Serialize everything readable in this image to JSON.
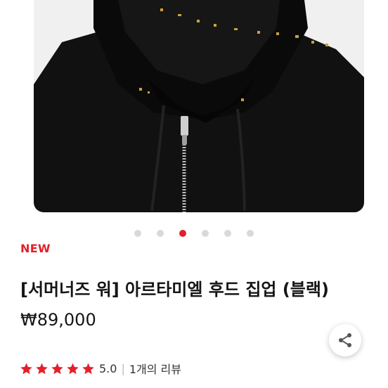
{
  "product": {
    "badge": "NEW",
    "title": "[서머너즈 워] 아르타미엘 후드 집업 (블랙)",
    "price": "₩89,000",
    "rating": {
      "stars": 5,
      "score": "5.0",
      "separator": "|",
      "reviews": "1개의 리뷰"
    }
  },
  "carousel": {
    "total": 6,
    "active_index": 2
  },
  "icons": {
    "share": "share-icon",
    "star": "star-icon"
  },
  "colors": {
    "accent": "#e3202a",
    "star": "#e3202a",
    "dot_inactive": "#d9d9d9"
  }
}
